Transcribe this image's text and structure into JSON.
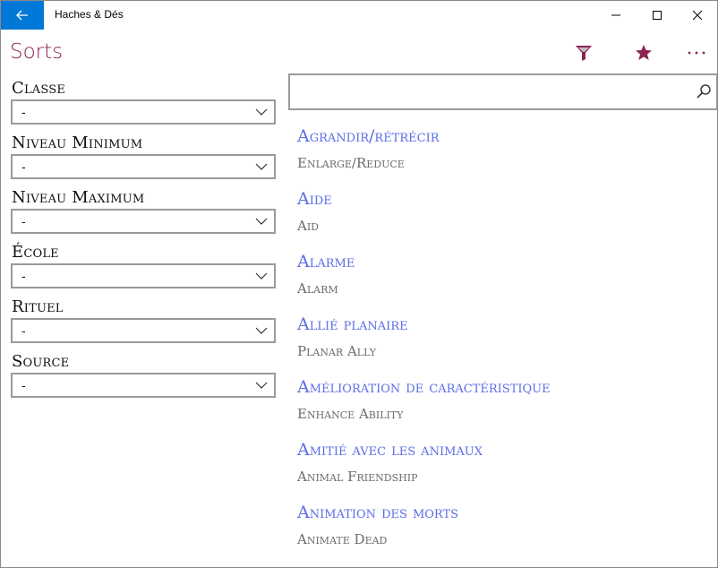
{
  "window": {
    "app_title": "Haches & Dés",
    "back_icon": "arrow-left-icon",
    "minimize_icon": "minimize-icon",
    "maximize_icon": "maximize-icon",
    "close_icon": "close-icon"
  },
  "appbar": {
    "title": "Sorts",
    "accent_color": "#8c2352",
    "icons": [
      "filter-icon",
      "star-icon",
      "more-icon"
    ]
  },
  "filters": [
    {
      "label": "Classe",
      "value": "-"
    },
    {
      "label": "Niveau Minimum",
      "value": "-"
    },
    {
      "label": "Niveau Maximum",
      "value": "-"
    },
    {
      "label": "École",
      "value": "-"
    },
    {
      "label": "Rituel",
      "value": "-"
    },
    {
      "label": "Source",
      "value": "-"
    }
  ],
  "search": {
    "value": "",
    "icon": "search-icon"
  },
  "spells": [
    {
      "name": "Agrandir/rétrécir",
      "english": "Enlarge/Reduce"
    },
    {
      "name": "Aide",
      "english": "Aid"
    },
    {
      "name": "Alarme",
      "english": "Alarm"
    },
    {
      "name": "Allié planaire",
      "english": "Planar Ally"
    },
    {
      "name": "Amélioration de caractéristique",
      "english": "Enhance Ability"
    },
    {
      "name": "Amitié avec les animaux",
      "english": "Animal Friendship"
    },
    {
      "name": "Animation des morts",
      "english": "Animate Dead"
    }
  ]
}
